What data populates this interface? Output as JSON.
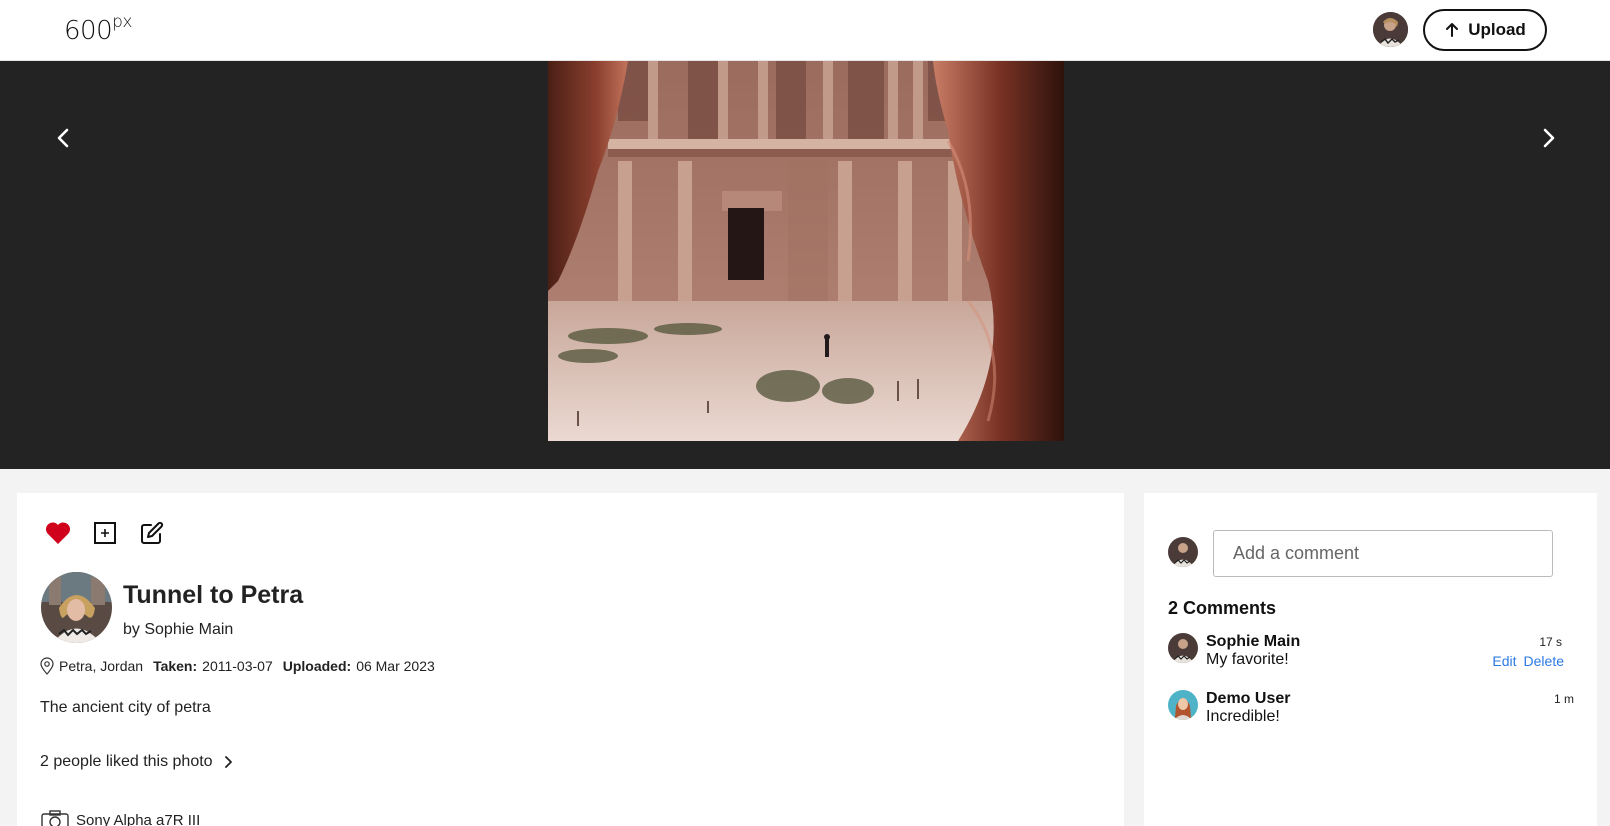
{
  "header": {
    "logo_main": "600",
    "logo_sup": "px",
    "upload_label": "Upload",
    "upload_icon": "arrow-up-icon",
    "avatar": "user-avatar"
  },
  "stage": {
    "prev_icon": "chevron-left-icon",
    "next_icon": "chevron-right-icon",
    "background": "#232323"
  },
  "photo": {
    "title": "Tunnel to Petra",
    "byline_prefix": "by",
    "author": "Sophie Main",
    "location": "Petra, Jordan",
    "taken_label": "Taken:",
    "taken_value": "2011-03-07",
    "uploaded_label": "Uploaded:",
    "uploaded_value": "06 Mar 2023",
    "description": "The ancient city of petra",
    "likes_text": "2 people liked this photo",
    "camera": "Sony Alpha a7R III"
  },
  "actions": {
    "like_icon": "heart-icon",
    "add_icon": "add-to-gallery-icon",
    "edit_icon": "edit-icon",
    "like_color": "#d0021b"
  },
  "comments": {
    "placeholder": "Add a comment",
    "count_label": "2 Comments",
    "items": [
      {
        "name": "Sophie Main",
        "text": "My favorite!",
        "time": "17 s",
        "edit": "Edit",
        "delete": "Delete"
      },
      {
        "name": "Demo User",
        "text": "Incredible!",
        "time": "1 m"
      }
    ],
    "link_color": "#2c7be5"
  }
}
